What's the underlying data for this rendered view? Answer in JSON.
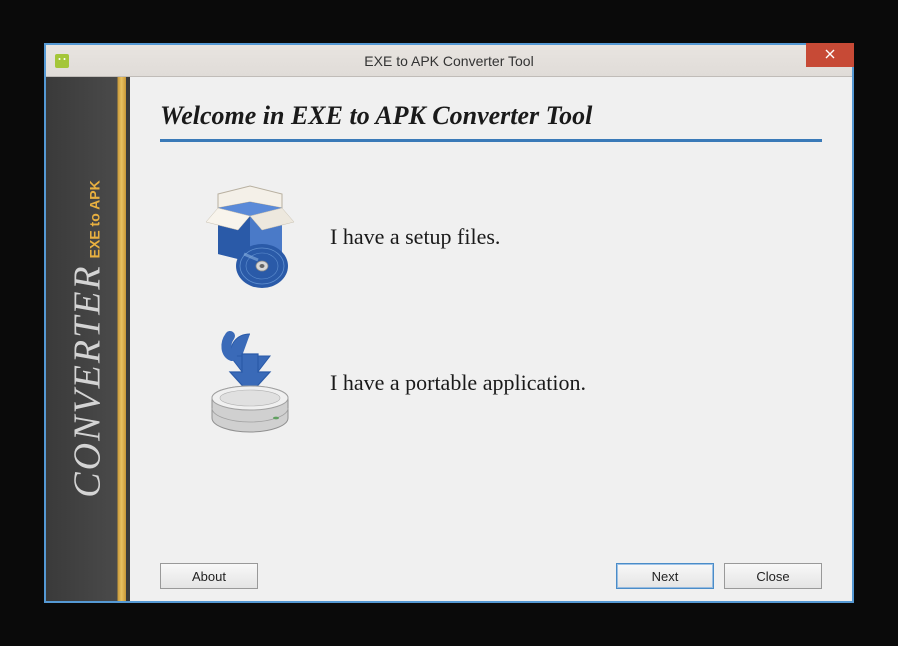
{
  "window": {
    "title": "EXE to APK Converter Tool"
  },
  "sidebar": {
    "line1": "EXE to APK",
    "line2": "CONVERTER"
  },
  "main": {
    "heading": "Welcome in EXE to APK Converter Tool",
    "options": [
      {
        "label": "I have a setup files."
      },
      {
        "label": "I have a portable application."
      }
    ]
  },
  "footer": {
    "about": "About",
    "next": "Next",
    "close": "Close"
  }
}
